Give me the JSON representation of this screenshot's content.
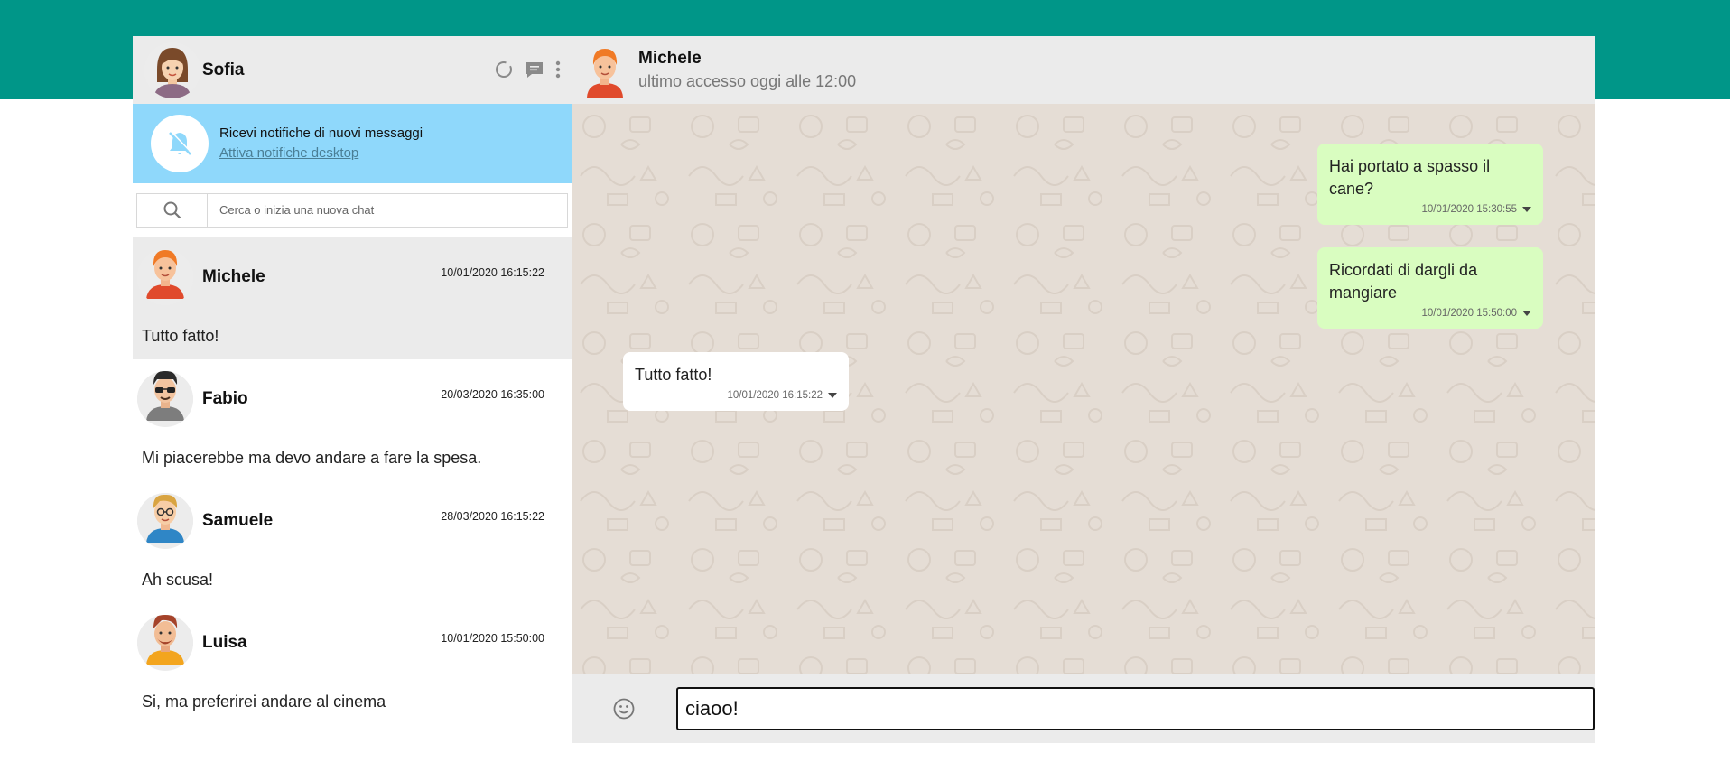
{
  "user": {
    "name": "Sofia"
  },
  "notification": {
    "title": "Ricevi notifiche di nuovi messaggi",
    "link": "Attiva notifiche desktop"
  },
  "search": {
    "placeholder": "Cerca o inizia una nuova chat"
  },
  "contacts": [
    {
      "name": "Michele",
      "date": "10/01/2020 16:15:22",
      "last": "Tutto fatto!",
      "active": true
    },
    {
      "name": "Fabio",
      "date": "20/03/2020 16:35:00",
      "last": "Mi piacerebbe ma devo andare a fare la spesa."
    },
    {
      "name": "Samuele",
      "date": "28/03/2020 16:15:22",
      "last": "Ah scusa!"
    },
    {
      "name": "Luisa",
      "date": "10/01/2020 15:50:00",
      "last": "Si, ma preferirei andare al cinema"
    }
  ],
  "chat": {
    "name": "Michele",
    "status": "ultimo accesso oggi alle 12:00",
    "messages": [
      {
        "type": "sent",
        "text": "Hai portato a spasso il cane?",
        "date": "10/01/2020 15:30:55"
      },
      {
        "type": "sent",
        "text": "Ricordati di dargli da mangiare",
        "date": "10/01/2020 15:50:00"
      },
      {
        "type": "received",
        "text": "Tutto fatto!",
        "date": "10/01/2020 16:15:22"
      }
    ]
  },
  "composer": {
    "value": "ciaoo!"
  },
  "colors": {
    "topband": "#009688",
    "sent": "#d9fdc0",
    "received": "#ffffff",
    "notification": "#8fd8fb",
    "chat_background": "#e5ddd5"
  },
  "icons": [
    "status-icon",
    "chat-icon",
    "menu-icon",
    "bell-off-icon",
    "search-icon",
    "emoji-icon",
    "caret-down-icon"
  ]
}
